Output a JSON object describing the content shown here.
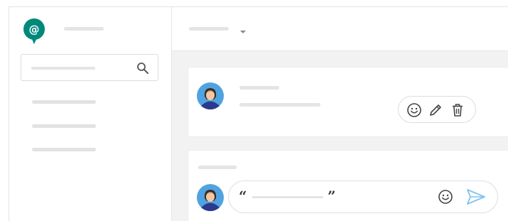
{
  "app": {
    "logo_icon": "hangouts-chat-logo-icon",
    "brand_color": "#00897b"
  },
  "sidebar": {
    "search": {
      "placeholder": "",
      "icon": "search-icon"
    },
    "items": [
      {
        "label": ""
      },
      {
        "label": ""
      },
      {
        "label": ""
      }
    ]
  },
  "header": {
    "title": "",
    "dropdown_icon": "chevron-down-icon"
  },
  "messages": [
    {
      "sender": "",
      "text": "",
      "actions": [
        "smiley-icon",
        "pencil-icon",
        "trash-icon"
      ]
    }
  ],
  "reply": {
    "title": "",
    "open_quote": "“",
    "close_quote": "”",
    "draft_text": "",
    "emoji_icon": "smiley-icon",
    "send_icon": "send-icon",
    "send_color": "#7fc4ee"
  }
}
